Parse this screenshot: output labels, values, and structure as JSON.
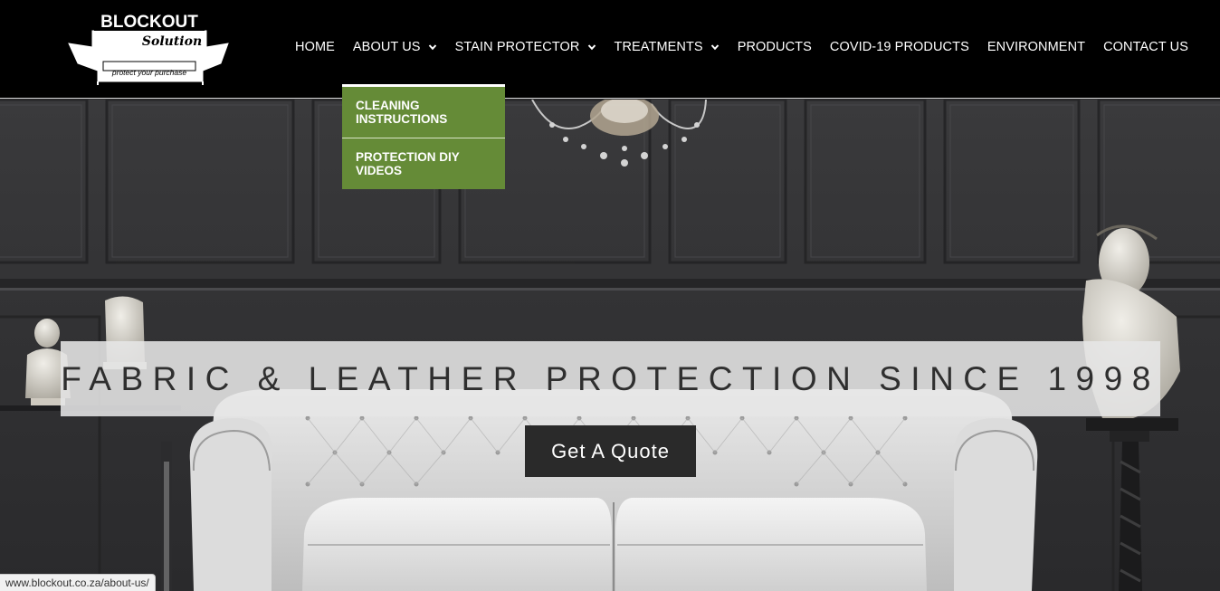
{
  "brand": {
    "name": "BLOCKOUT",
    "script": "Solution",
    "slogan": "protect your purchase"
  },
  "nav": {
    "items": [
      {
        "label": "HOME",
        "has_dropdown": false
      },
      {
        "label": "ABOUT US",
        "has_dropdown": true
      },
      {
        "label": "STAIN PROTECTOR",
        "has_dropdown": true
      },
      {
        "label": "TREATMENTS",
        "has_dropdown": true
      },
      {
        "label": "PRODUCTS",
        "has_dropdown": false
      },
      {
        "label": "COVID-19 PRODUCTS",
        "has_dropdown": false
      },
      {
        "label": "ENVIRONMENT",
        "has_dropdown": false
      },
      {
        "label": "CONTACT US",
        "has_dropdown": false
      }
    ]
  },
  "dropdown": {
    "parent": "ABOUT US",
    "items": [
      {
        "label": "CLEANING INSTRUCTIONS"
      },
      {
        "label": "PROTECTION DIY VIDEOS"
      }
    ]
  },
  "hero": {
    "tagline": "FABRIC & LEATHER PROTECTION SINCE 1998",
    "cta_label": "Get A Quote"
  },
  "status_bar": {
    "url": "www.blockout.co.za/about-us/"
  },
  "colors": {
    "header_bg": "#000000",
    "dropdown_bg": "#658b37",
    "cta_bg": "#2a2a2a",
    "tagline_bg": "#e6e6e6"
  }
}
